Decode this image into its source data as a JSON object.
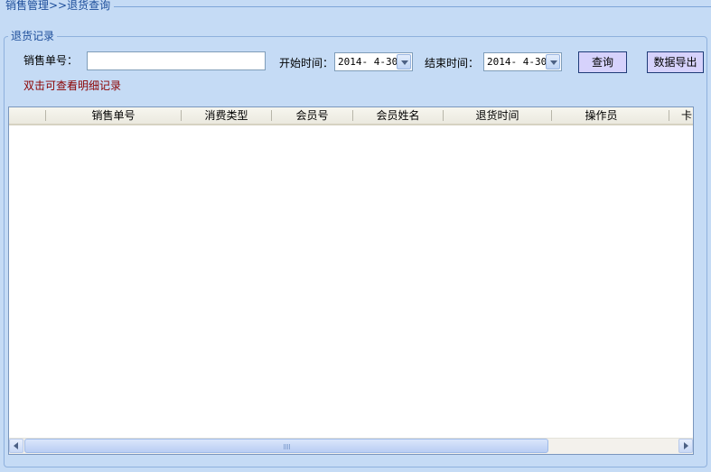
{
  "breadcrumb": "销售管理>>退货查询",
  "group_title": "退货记录",
  "filters": {
    "order_label": "销售单号：",
    "order_value": "",
    "start_label": "开始时间：",
    "start_value": "2014- 4-30",
    "end_label": "结束时间：",
    "end_value": "2014- 4-30"
  },
  "buttons": {
    "query": "查询",
    "export": "数据导出"
  },
  "hint": "双击可查看明细记录",
  "table": {
    "columns": [
      "销售单号",
      "消费类型",
      "会员号",
      "会员姓名",
      "退货时间",
      "操作员",
      "卡"
    ],
    "rows": []
  },
  "colors": {
    "background": "#c5dbf5",
    "title_blue": "#1c4d9a",
    "hint_red": "#8b0000",
    "button_fill": "#d6d2fc"
  },
  "icons": {
    "date_dropdown": "chevron-down-icon",
    "scroll_left": "chevron-left-icon",
    "scroll_right": "chevron-right-icon"
  }
}
